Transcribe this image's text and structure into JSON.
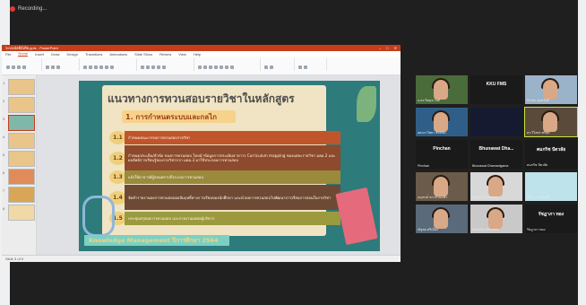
{
  "recording_label": "Recording...",
  "ppt": {
    "title_bar_text": "ระบบมัลติมีเดีย.pptx - PowerPoint",
    "menu": [
      "File",
      "Home",
      "Insert",
      "Draw",
      "Design",
      "Transitions",
      "Animations",
      "Slide Show",
      "Review",
      "View",
      "Help"
    ],
    "active_menu": "Home",
    "status_text": "Slide 3 of 9"
  },
  "slide": {
    "title": "แนวทางการทวนสอบรายวิชาในหลักสูตร",
    "section_heading": "1. การกำหนดระบบและกลไก",
    "items": [
      {
        "num": "1.1",
        "text": "กำหนดคณะกรรมการทวนสอบรายวิชา",
        "color": "#c0552b"
      },
      {
        "num": "1.2",
        "text": "กำหนดประเด็น/หัวข้อ ของการทวนสอบ โดยนำข้อมูลการประเมินจากการ Curriculum mapping ของแต่ละรายวิชา มคอ.2 และผลลัพธ์การเรียนรู้ของรายวิชาจาก มคอ.3 มาใช้ประกอบการทวนสอบ",
        "color": "#8d4a2c"
      },
      {
        "num": "1.3",
        "text": "แจ้งให้อาจารย์ผู้สอนทราบถึงระบบการทวนสอบ",
        "color": "#9a8a3c"
      },
      {
        "num": "1.4",
        "text": "จัดทำรายงานผลการทวนสอบผลสัมฤทธิ์ทางการเรียนของนักศึกษา และนำผลการทวนสอบไปพัฒนาการเรียนการสอนในรายวิชา",
        "color": "#6e4a34"
      },
      {
        "num": "1.5",
        "text": "ประชุมสรุปผลการทวนสอบ และรายงานผลต่อผู้บริหาร",
        "color": "#9b9a3e"
      }
    ],
    "footer_banner": "Knowledge Management ปีการศึกษา 2564"
  },
  "participants": [
    {
      "name": "อ.ดร.ปิยนุช ใจดี",
      "label": ""
    },
    {
      "name": "",
      "label": "KKU FMS"
    },
    {
      "name": "จิราพร สุขสวัสดิ์",
      "label": ""
    },
    {
      "name": "ผศ.ดร.วิทยา สิทธิชัย",
      "label": ""
    },
    {
      "name": "",
      "label": ""
    },
    {
      "name": "ดร.วิไลพร ศรีสุข",
      "label": ""
    },
    {
      "name": "Pinchan",
      "label": "Pinchan"
    },
    {
      "name": "Bhunawat Dhamanigama",
      "label": "Bhunawat Dha..."
    },
    {
      "name": "คมกริช ปัตวลัย",
      "label": "คมกริช ปัตวลัย"
    },
    {
      "name": "อนุสรณ์ ชาวบ้านแพ้ว",
      "label": ""
    },
    {
      "name": "กาญจนา นาคสกุล",
      "label": ""
    },
    {
      "name": "ปวีณา วงศ์ทองดี",
      "label": ""
    },
    {
      "name": "ณัฐพล ศรีเมือง",
      "label": ""
    },
    {
      "name": "เพชรรัตน์ ชัยมงคล",
      "label": ""
    },
    {
      "name": "รัชฎาภา ทอง",
      "label": "รัชฎาภา ทอง"
    }
  ]
}
